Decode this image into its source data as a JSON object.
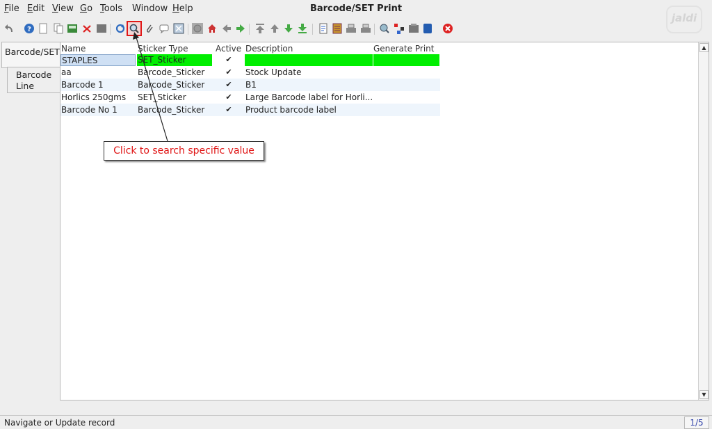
{
  "window": {
    "title": "Barcode/SET Print",
    "logo": "jaldi"
  },
  "menu": [
    {
      "mnemonic": "F",
      "rest": "ile"
    },
    {
      "mnemonic": "E",
      "rest": "dit"
    },
    {
      "mnemonic": "V",
      "rest": "iew"
    },
    {
      "mnemonic": "G",
      "rest": "o"
    },
    {
      "mnemonic": "T",
      "rest": "ools"
    },
    {
      "mnemonic": "",
      "rest": "Window"
    },
    {
      "mnemonic": "H",
      "rest": "elp"
    }
  ],
  "toolbar": {
    "icons": [
      "undo-icon",
      "help-icon",
      "new-record-icon",
      "copy-record-icon",
      "save-icon",
      "delete-icon",
      "print-preview-icon",
      "refresh-icon",
      "find-icon",
      "attachment-icon",
      "chat-icon",
      "zoom-icon",
      "history-icon",
      "home-icon",
      "previous-icon",
      "next-icon",
      "first-icon",
      "parent-icon",
      "detail-icon",
      "last-icon",
      "report-icon",
      "archive-icon",
      "print-icon",
      "print-2-icon",
      "zoom-across-icon",
      "workflow-icon",
      "product-info-icon",
      "window-icon",
      "close-window-icon"
    ]
  },
  "tabs": [
    {
      "label": "Barcode/SET"
    },
    {
      "label": "Barcode Line"
    }
  ],
  "grid": {
    "headers": {
      "name": "Name",
      "sticker_type": "Sticker Type",
      "active": "Active",
      "description": "Description",
      "generate_print": "Generate Print"
    },
    "rows": [
      {
        "name": "STAPLES",
        "sticker_type": "SET_Sticker",
        "active": true,
        "description": "",
        "generate_print": ""
      },
      {
        "name": "aa",
        "sticker_type": "Barcode_Sticker",
        "active": true,
        "description": "Stock Update",
        "generate_print": ""
      },
      {
        "name": "Barcode 1",
        "sticker_type": "Barcode_Sticker",
        "active": true,
        "description": "B1",
        "generate_print": ""
      },
      {
        "name": "Horlics 250gms",
        "sticker_type": "SET_Sticker",
        "active": true,
        "description": "Large Barcode label for Horli...",
        "generate_print": ""
      },
      {
        "name": "Barcode No 1",
        "sticker_type": "Barcode_Sticker",
        "active": true,
        "description": "Product barcode label",
        "generate_print": ""
      }
    ],
    "check_glyph": "✔"
  },
  "callout": {
    "text": "Click to search specific value"
  },
  "status": {
    "message": "Navigate or Update record",
    "record_count": "1/5"
  },
  "colors": {
    "highlight_green": "#00ee00",
    "selected_blue": "#cfe0f4",
    "alt_row": "#eef5fc",
    "callout_red": "#e01414"
  }
}
